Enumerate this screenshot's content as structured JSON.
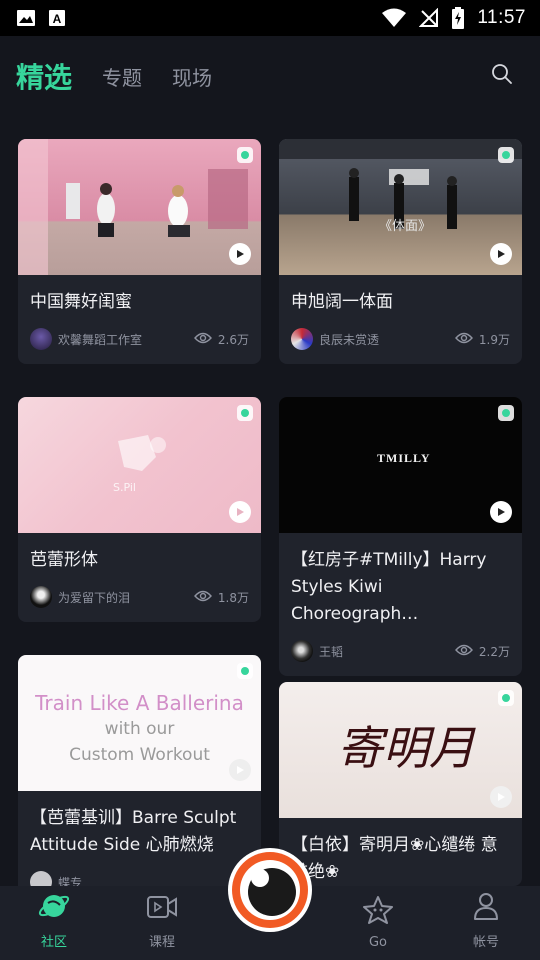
{
  "status_bar": {
    "time": "11:57",
    "left_icons": [
      "image-icon",
      "font-icon"
    ],
    "right_icons": [
      "wifi-icon",
      "no-signal-icon",
      "battery-charging-icon"
    ]
  },
  "tabs": [
    {
      "label": "精选",
      "active": true
    },
    {
      "label": "专题",
      "active": false
    },
    {
      "label": "现场",
      "active": false
    }
  ],
  "search_icon": "search-icon",
  "cards": [
    {
      "title": "中国舞好闺蜜",
      "author": "欢馨舞蹈工作室",
      "views": "2.6万",
      "thumb_text": ""
    },
    {
      "title": "申旭阔一体面",
      "author": "良辰未赏透",
      "views": "1.9万",
      "thumb_text": "《体面》"
    },
    {
      "title": "芭蕾形体",
      "author": "为爱留下的泪",
      "views": "1.8万",
      "thumb_text": ""
    },
    {
      "title": "【红房子#TMilly】Harry Styles Kiwi Choreograph…",
      "author": "王韬",
      "views": "2.2万",
      "thumb_text": "TMILLY"
    },
    {
      "title": "【芭蕾基训】Barre Sculpt Attitude Side 心肺燃烧",
      "author": "蝶专",
      "views": "",
      "thumb_text": "Train Like A Ballerina",
      "thumb_sub1": "with our",
      "thumb_sub2": "Custom Workout"
    },
    {
      "title": "【白依】寄明月❀心缱绻 意难绝❀",
      "author": "",
      "views": "",
      "thumb_text": "寄明月"
    }
  ],
  "nav": [
    {
      "label": "社区",
      "icon": "planet-icon",
      "active": true
    },
    {
      "label": "课程",
      "icon": "video-icon",
      "active": false
    },
    {
      "label": "Go",
      "icon": "star-icon",
      "active": false
    },
    {
      "label": "帐号",
      "icon": "user-icon",
      "active": false
    }
  ],
  "colors": {
    "accent": "#37d59c",
    "bg": "#14161d",
    "card": "#20232c",
    "nav": "#1d2029"
  }
}
